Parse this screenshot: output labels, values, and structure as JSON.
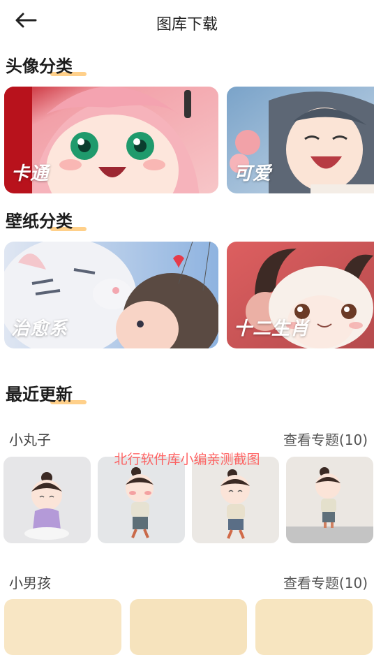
{
  "header": {
    "title": "图库下载",
    "back_icon": "arrow-left-icon"
  },
  "avatar_section": {
    "title": "头像分类",
    "cards": [
      {
        "label": "卡通"
      },
      {
        "label": "可爱"
      }
    ]
  },
  "wallpaper_section": {
    "title": "壁纸分类",
    "cards": [
      {
        "label": "治愈系"
      },
      {
        "label": "十二生肖"
      }
    ]
  },
  "recent_section": {
    "title": "最近更新",
    "topics": [
      {
        "name": "小丸子",
        "more": "查看专题(10)"
      },
      {
        "name": "小男孩",
        "more": "查看专题(10)"
      }
    ]
  },
  "watermark": "北行软件库小编亲测截图",
  "colors": {
    "accent_underline": "#ffd08a",
    "watermark": "#ff4d4d"
  }
}
